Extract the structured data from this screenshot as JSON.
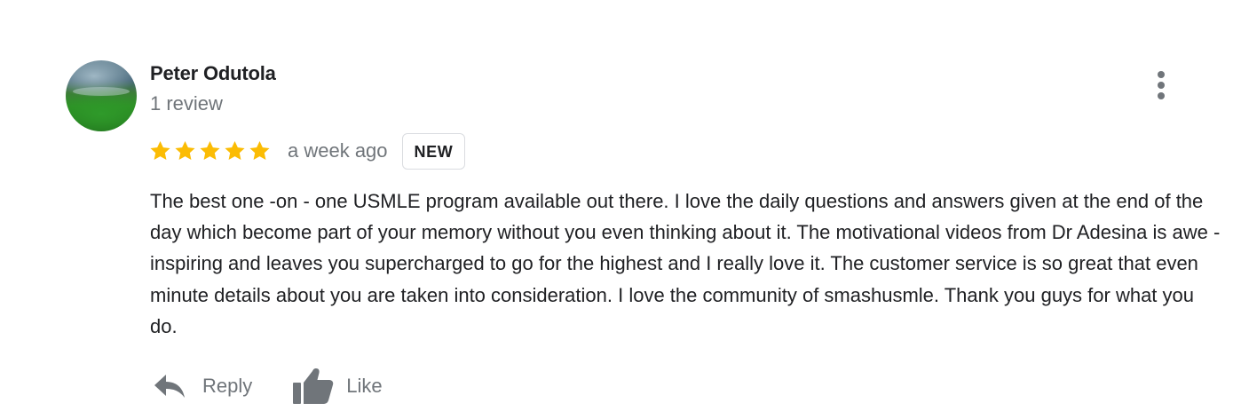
{
  "review": {
    "author": {
      "name": "Peter Odutola",
      "review_count_label": "1 review",
      "avatar": "avatar-photo-landscape"
    },
    "rating": {
      "stars": 5,
      "max": 5,
      "star_color": "#fbbc04"
    },
    "time_ago": "a week ago",
    "badge": "NEW",
    "text": "The best one -on - one USMLE program available out there. I love the daily questions and answers given at the end of the day which become part of your memory without you even thinking about it. The motivational videos from Dr Adesina is awe - inspiring and leaves you supercharged to go for the highest and I really love it. The customer service is so great that even minute details about you are taken into consideration. I love the community of smashusmle. Thank you guys for what you do.",
    "actions": {
      "reply": {
        "label": "Reply",
        "icon": "reply-arrow-icon"
      },
      "like": {
        "label": "Like",
        "icon": "thumbs-up-icon"
      }
    },
    "menu_icon": "more-vert-icon"
  },
  "colors": {
    "primary_text": "#202124",
    "secondary_text": "#70757a",
    "badge_border": "#dadce0"
  }
}
